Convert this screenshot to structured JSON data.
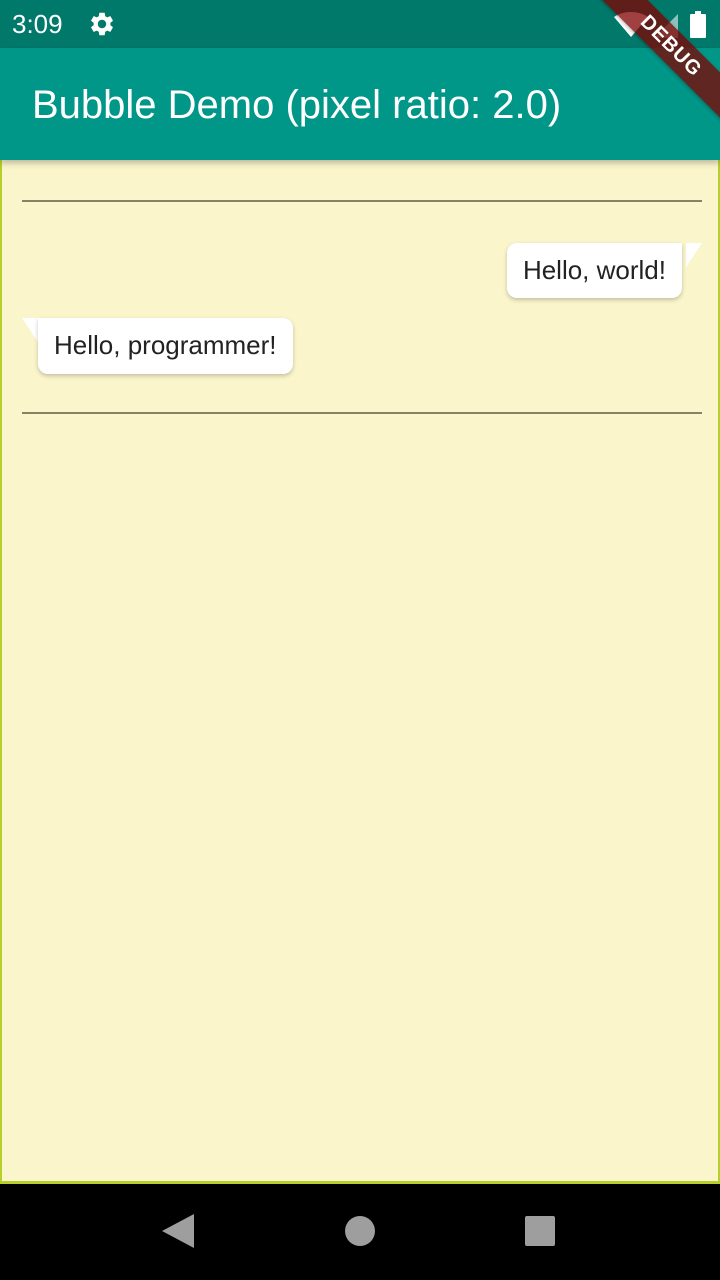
{
  "status_bar": {
    "time": "3:09",
    "icons": [
      "gear-icon",
      "wifi-icon",
      "signal-icon",
      "battery-icon"
    ]
  },
  "app_bar": {
    "title": "Bubble Demo (pixel ratio: 2.0)"
  },
  "debug_banner": {
    "label": "DEBUG"
  },
  "messages": [
    {
      "text": "Hello, world!",
      "side": "right"
    },
    {
      "text": "Hello, programmer!",
      "side": "left"
    }
  ],
  "nav_bar": {
    "icons": [
      "back-icon",
      "home-icon",
      "recents-icon"
    ]
  },
  "colors": {
    "status_bar": "#00796b",
    "app_bar": "#009688",
    "background": "#faf5cb",
    "bubble": "#ffffff",
    "divider": "#8a8066",
    "frame_border": "#b6cf2a"
  }
}
